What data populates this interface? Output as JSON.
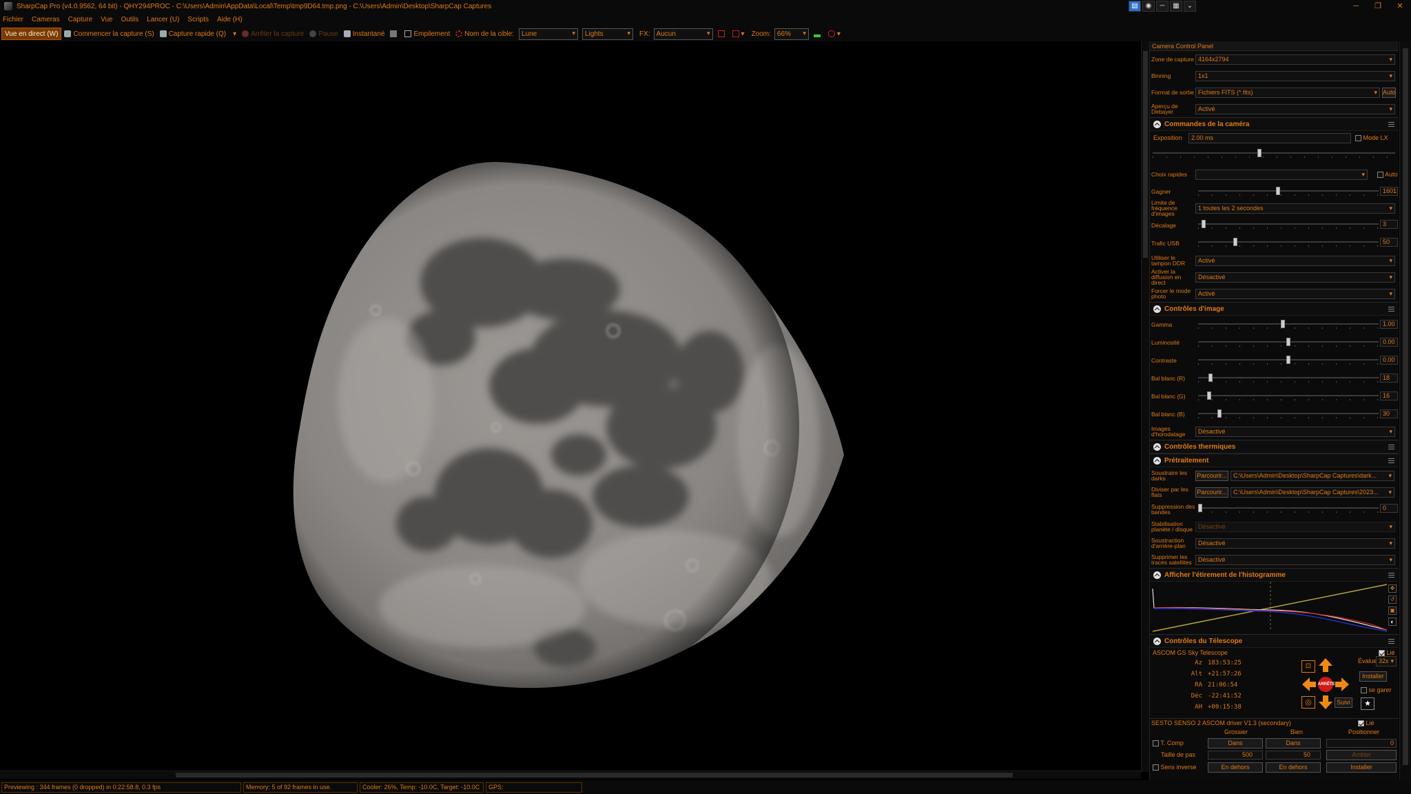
{
  "window": {
    "title": "SharpCap Pro (v4.0.9562, 64 bit) - QHY294PROC - C:\\Users\\Admin\\AppData\\Local\\Temp\\tmp9D64.tmp.png - C:\\Users\\Admin\\Desktop\\SharpCap Captures",
    "controls": {
      "minimize": "─",
      "restore": "❐",
      "close": "✕"
    }
  },
  "menu": [
    "Fichier",
    "Cameras",
    "Capture",
    "Vue",
    "Outils",
    "Lancer (U)",
    "Scripts",
    "Aide (H)"
  ],
  "toolbar": {
    "live_view": "Vue en direct (W)",
    "start_capture": "Commencer la capture (S)",
    "quick_capture": "Capture rapide (Q)",
    "stop_capture": "Arrêter la capture",
    "pause": "Pause",
    "snapshot": "Instantané",
    "stacking": "Empilement",
    "target_label": "Nom de la cible:",
    "target_value": "Lune",
    "frame_type": "Lights",
    "fx_label": "FX:",
    "fx_value": "Aucun",
    "zoom_label": "Zoom:",
    "zoom_value": "66%"
  },
  "panel": {
    "title": "Camera Control Panel",
    "capture_area": {
      "label": "Zone de capture",
      "value": "4164x2794"
    },
    "binning": {
      "label": "Binning",
      "value": "1x1"
    },
    "output_format": {
      "label": "Format de sortie",
      "value": "Fichiers FITS (*.fits)",
      "auto": "Auto"
    },
    "debayer_preview": {
      "label": "Aperçu de Debayer",
      "value": "Activé"
    },
    "camera_controls": {
      "title": "Commandes de la caméra",
      "exposure": {
        "label": "Exposition",
        "value": "2.00 ms",
        "lx_mode": "Mode LX",
        "slider": 0.44
      },
      "quick_picks": {
        "label": "Choix rapides",
        "value": "",
        "auto": "Auto"
      },
      "gain": {
        "label": "Gagner",
        "value": "1601",
        "slider": 0.44
      },
      "frame_rate_limit": {
        "label": "Limite de fréquence d'images",
        "value": "1 toutes les 2 secondes"
      },
      "offset": {
        "label": "Décalage",
        "value": "3",
        "slider": 0.02
      },
      "usb_traffic": {
        "label": "Trafic USB",
        "value": "50",
        "slider": 0.2
      },
      "ddr_buffer": {
        "label": "Utiliser le tampon DDR",
        "value": "Activé"
      },
      "live_streaming": {
        "label": "Activer la diffusion en direct",
        "value": "Désactivé"
      },
      "photo_mode": {
        "label": "Forcer le mode photo",
        "value": "Activé"
      }
    },
    "image_controls": {
      "title": "Contrôles d'image",
      "gamma": {
        "label": "Gamma",
        "value": "1.00",
        "slider": 0.47
      },
      "brightness": {
        "label": "Luminosité",
        "value": "0.00",
        "slider": 0.5
      },
      "contrast": {
        "label": "Contraste",
        "value": "0.00",
        "slider": 0.5
      },
      "wb_r": {
        "label": "Bal blanc (R)",
        "value": "18",
        "slider": 0.06
      },
      "wb_g": {
        "label": "Bal blanc (G)",
        "value": "16",
        "slider": 0.05
      },
      "wb_b": {
        "label": "Bal blanc (B)",
        "value": "30",
        "slider": 0.11
      },
      "timestamp": {
        "label": "Images d'horodatage",
        "value": "Désactivé"
      }
    },
    "thermal_controls": {
      "title": "Contrôles thermiques"
    },
    "preprocessing": {
      "title": "Prétraitement",
      "subtract_darks": {
        "label": "Soustraire les darks",
        "browse": "Parcourir...",
        "value": "C:\\Users\\Admin\\Desktop\\SharpCap Captures\\dark..."
      },
      "divide_flats": {
        "label": "Diviser par les flats",
        "browse": "Parcourir...",
        "value": "C:\\Users\\Admin\\Desktop\\SharpCap Captures\\2023..."
      },
      "banding": {
        "label": "Suppression des bandes",
        "value": "0",
        "slider": 0.0
      },
      "stabilization": {
        "label": "Stabilisation planète / disque",
        "value": "Désactivé"
      },
      "background_sub": {
        "label": "Soustraction d'arrière-plan",
        "value": "Désactivé"
      },
      "satellite_trails": {
        "label": "Supprimer les traces satellites",
        "value": "Désactivé"
      }
    },
    "histogram": {
      "title": "Afficher l'étirement de l'histogramme"
    },
    "telescope": {
      "title": "Contrôles du Télescope",
      "device": "ASCOM GS Sky Telescope",
      "linked": "Lié",
      "coords": [
        {
          "k": "Az",
          "v": "183:53:25"
        },
        {
          "k": "Alt",
          "v": "+21:57:26"
        },
        {
          "k": "RA",
          "v": "21:06:54"
        },
        {
          "k": "Déc",
          "v": "-22:41:52"
        },
        {
          "k": "AH",
          "v": "+00:15:38"
        }
      ],
      "stop": "ARRÊTE",
      "evaluate_label": "Évaluer:",
      "evaluate_value": "32x",
      "install": "Installer",
      "park": "se garer",
      "track": "Suivi"
    },
    "focuser": {
      "device": "SESTO SENSO 2 ASCOM driver V1.3 (secondary)",
      "linked": "Lié",
      "coarse": "Grossier",
      "fine": "Bien",
      "position": "Positionner",
      "temp_comp": "T. Comp",
      "in": "Dans",
      "position_value": "0",
      "step_size": "Taille de pas",
      "coarse_step": "500",
      "fine_step": "50",
      "stop": "Arrêter",
      "reverse": "Sens inverse",
      "out": "En dehors",
      "install": "Installer"
    }
  },
  "status": {
    "previewing": "Previewing : 344 frames (0 dropped) in 0:22:58.8, 0.3 fps",
    "memory": "Memory: 5 of 92 frames in use.",
    "cooler": "Cooler: 26%, Temp: -10.0C, Target: -10.0C",
    "gps": "GPS:"
  },
  "colors": {
    "accent": "#e07a18",
    "active_bg": "#7a3a05",
    "panel_bg": "#0b0b0b"
  },
  "icons": {
    "live_view": "live-view-icon",
    "camera": "camera-icon",
    "stop": "stop-icon",
    "pause": "pause-icon",
    "snapshot": "snapshot-icon",
    "stack": "stack-icon",
    "target": "target-icon"
  }
}
